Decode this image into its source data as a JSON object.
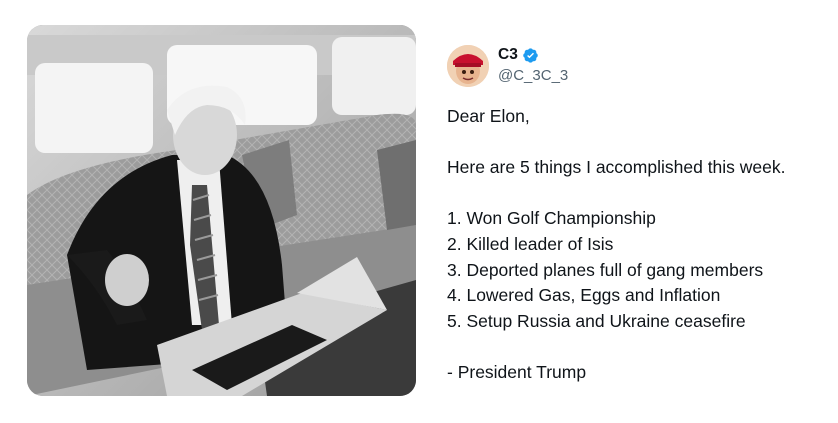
{
  "author": {
    "display_name": "C3",
    "handle": "@C_3C_3",
    "verified": true,
    "avatar_icon": "profile-avatar"
  },
  "media": {
    "description_icon": "photo-man-at-laptop"
  },
  "tweet": {
    "greeting": "Dear Elon,",
    "intro": "Here are 5 things I accomplished this week.",
    "items": [
      "1. Won Golf Championship",
      "2. Killed leader of Isis",
      "3. Deported planes full of gang members",
      "4. Lowered Gas, Eggs and Inflation",
      "5. Setup Russia and Ukraine ceasefire"
    ],
    "signature": "- President Trump"
  },
  "colors": {
    "text": "#0f1419",
    "secondary": "#536471",
    "verified": "#1d9bf0"
  }
}
